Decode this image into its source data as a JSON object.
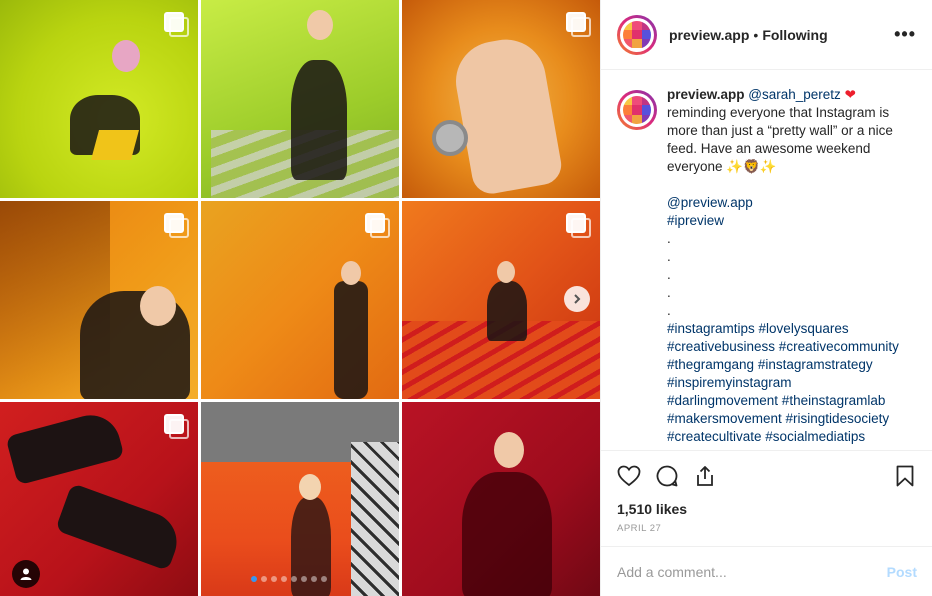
{
  "header": {
    "username": "preview.app",
    "separator": "•",
    "follow_status": "Following",
    "more_label": "•••"
  },
  "caption": {
    "username": "preview.app",
    "mention": "@sarah_peretz",
    "heart": "❤",
    "lines": [
      "reminding everyone that Instagram is",
      "more than just a “pretty wall” or a nice",
      "feed. Have an awesome weekend",
      "everyone ✨🦁✨"
    ],
    "account_tag": "@preview.app",
    "app_tag": "#ipreview",
    "dots": [
      ".",
      ".",
      ".",
      ".",
      "."
    ],
    "hashtag_lines": [
      "#instagramtips #lovelysquares",
      "#creativebusiness #creativecommunity",
      "#thegramgang #instagramstrategy",
      "#inspiremyinstagram",
      "#darlingmovement #theinstagramlab",
      "#makersmovement #risingtidesociety",
      "#createcultivate #socialmediatips"
    ]
  },
  "actions": {
    "likes": "1,510 likes",
    "date": "April 27"
  },
  "comment": {
    "placeholder": "Add a comment...",
    "post_label": "Post"
  },
  "media": {
    "carousel_dots": 8,
    "active_dot": 0
  },
  "colors": {
    "link": "#003569",
    "post_disabled": "#b3dbff",
    "story_ring": [
      "#f58529",
      "#dd2a7b",
      "#8134af"
    ],
    "logo_grid": [
      "#f7c744",
      "#ef4b7a",
      "#c13584",
      "#fd7e3a",
      "#e1306c",
      "#5851db",
      "#f2586b",
      "#f1a340",
      "#833ab4"
    ]
  }
}
